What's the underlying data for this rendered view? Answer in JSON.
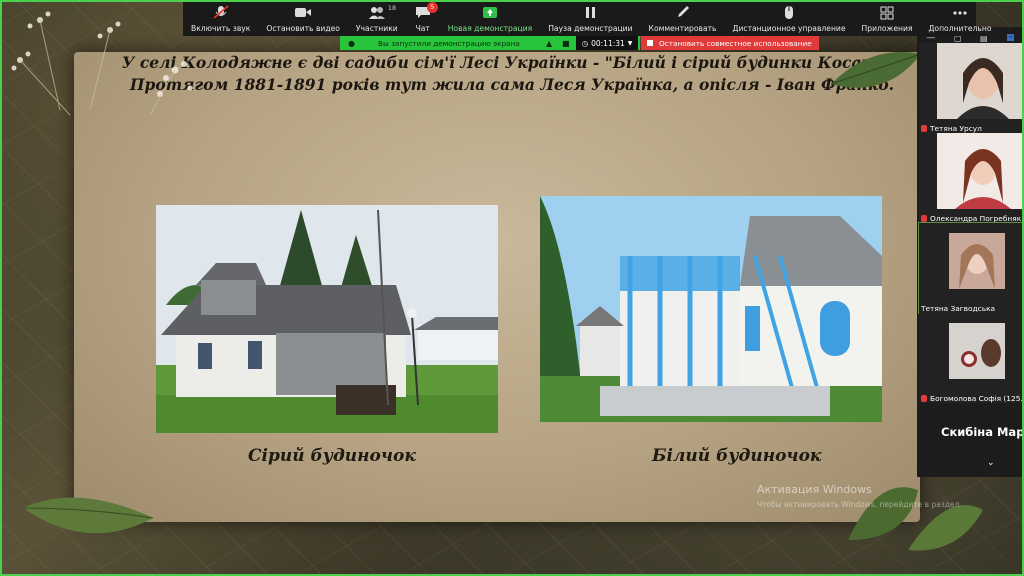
{
  "toolbar": {
    "items": [
      {
        "label": "Включить звук",
        "icon": "mic-muted-icon"
      },
      {
        "label": "Остановить видео",
        "icon": "video-camera-icon"
      },
      {
        "label": "Участники",
        "icon": "participants-icon",
        "count": "18"
      },
      {
        "label": "Чат",
        "icon": "chat-icon",
        "badge": "5"
      },
      {
        "label": "Новая демонстрация",
        "icon": "share-screen-icon"
      },
      {
        "label": "Пауза демонстрации",
        "icon": "pause-icon"
      },
      {
        "label": "Комментировать",
        "icon": "annotate-pencil-icon"
      },
      {
        "label": "Дистанционное управление",
        "icon": "remote-control-icon"
      },
      {
        "label": "Приложения",
        "icon": "apps-icon"
      },
      {
        "label": "Дополнительно",
        "icon": "more-dots-icon"
      }
    ]
  },
  "share_banner": {
    "text": "Вы запустили демонстрацию экрана",
    "timer": "00:11:31",
    "stop_label": "Остановить совместное использование"
  },
  "slide": {
    "line1": "У селі Колодяжне є дві садиби сім'ї Лесі Українки - \"Білий і сірий будинки Косачів\".",
    "line2": "Протягом 1881-1891 років тут жила сама Леся Українка, а опісля - Іван Франко.",
    "caption_left": "Сірий будиночок",
    "caption_right": "Білий будиночок"
  },
  "participants": [
    {
      "name": "Тетяна Урсул",
      "muted": true
    },
    {
      "name": "Олександра Погребняк",
      "muted": true
    },
    {
      "name": "Тетяна Загводська",
      "muted": false
    },
    {
      "name": "Богомолова Софія (125...",
      "muted": true
    }
  ],
  "speaker_label": "Скибіна Мар",
  "watermark": {
    "line1": "Активация Windows",
    "line2": "Чтобы активировать Windows, перейдите в раздел"
  },
  "colors": {
    "share_green": "#27c43c",
    "stop_red": "#e03a3a",
    "toolbar_bg": "#1a1a1a"
  }
}
